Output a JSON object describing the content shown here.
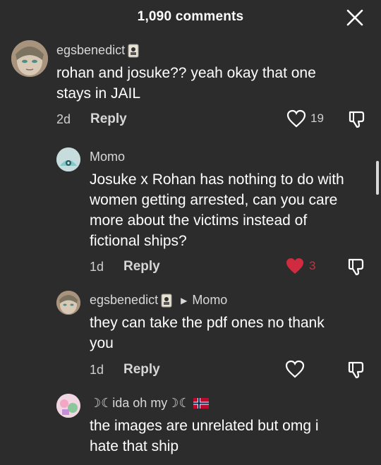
{
  "header": {
    "title": "1,090 comments"
  },
  "comments": [
    {
      "username": "egsbenedict",
      "text_lines": [
        "rohan and josuke?? yeah okay that one",
        "stays in JAIL"
      ],
      "time": "2d",
      "reply_label": "Reply",
      "likes": "19",
      "liked": false
    },
    {
      "username": "Momo",
      "text_lines": [
        "Josuke x Rohan has nothing to do with",
        "women getting arrested, can you care",
        "more about the victims instead of",
        "fictional ships?"
      ],
      "time": "1d",
      "reply_label": "Reply",
      "likes": "3",
      "liked": true
    },
    {
      "username": "egsbenedict",
      "reply_to": "Momo",
      "text_lines": [
        "they can take the pdf ones no thank",
        "you"
      ],
      "time": "1d",
      "reply_label": "Reply",
      "likes": "",
      "liked": false
    },
    {
      "username": "☽☾ida oh my☽☾",
      "text_lines": [
        "the images are unrelated but omg i",
        "hate that ship"
      ]
    }
  ],
  "colors": {
    "background": "#2c2c2c",
    "like_red": "#d02b3f",
    "text": "#ffffff",
    "muted": "#cfcfcf"
  },
  "icons": [
    "close-icon",
    "heart-icon",
    "dislike-icon",
    "reply-arrow-icon",
    "norway-flag-icon",
    "badge-icon"
  ]
}
